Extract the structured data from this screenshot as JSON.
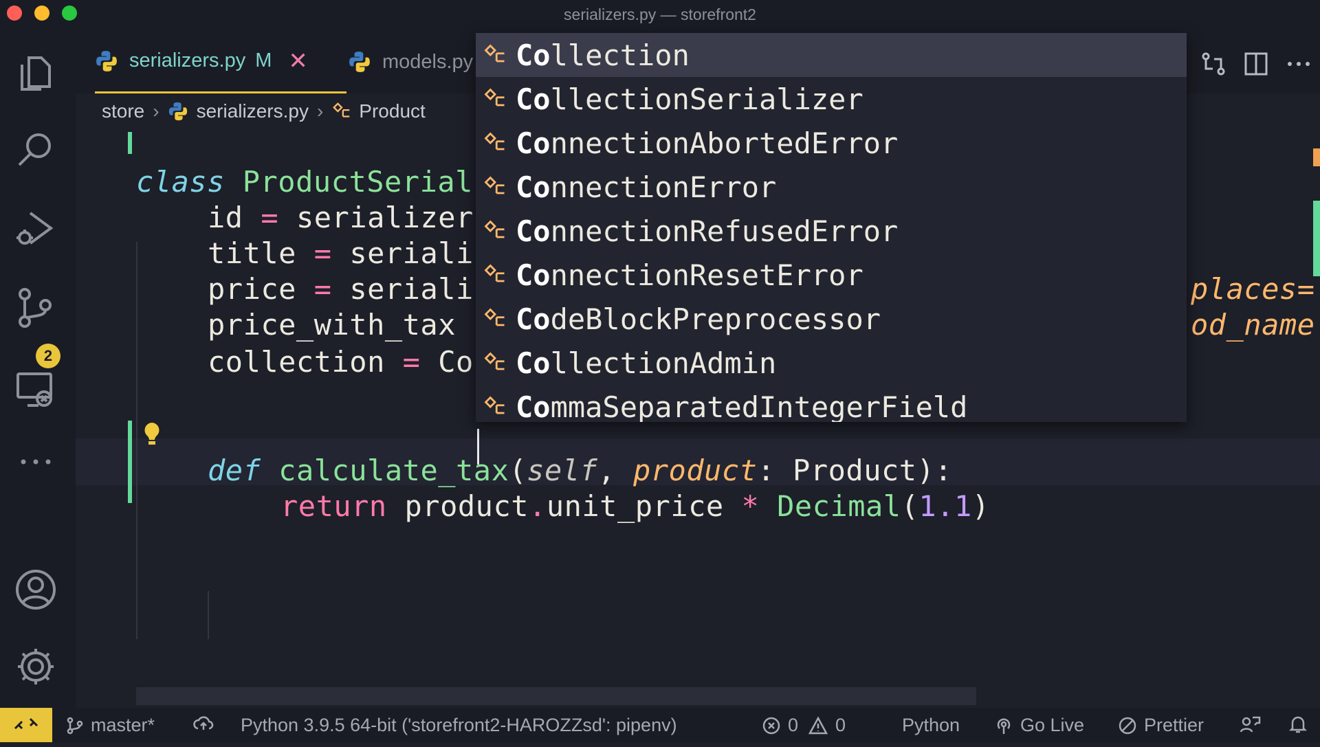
{
  "window": {
    "title": "serializers.py — storefront2"
  },
  "colors": {
    "accent": "#e8c53a",
    "tab_active_text": "#7ed4cb",
    "modified_gutter": "#63d99a",
    "remote_bg": "#e8c53a"
  },
  "activity_bar": {
    "items": [
      "explorer-icon",
      "search-icon",
      "run-debug-icon",
      "source-control-icon",
      "remote-explorer-icon",
      "more-icon"
    ],
    "scm_badge": "2",
    "bottom": [
      "accounts-icon",
      "settings-gear-icon"
    ]
  },
  "tabs": [
    {
      "label": "serializers.py",
      "status": "M",
      "close": "✕",
      "active": true
    },
    {
      "label": "models.py",
      "active": false
    }
  ],
  "breadcrumbs": [
    "store",
    "serializers.py",
    "Product"
  ],
  "code": {
    "line_class": {
      "kw": "class",
      "name": "ProductSerial"
    },
    "line_id": {
      "name": "id",
      "op": "=",
      "val": "serializer"
    },
    "line_title": {
      "name": "title",
      "op": "=",
      "val": "seriali"
    },
    "line_price": {
      "name": "price",
      "op": "=",
      "val": "seriali",
      "tail": "places="
    },
    "line_pwt": {
      "name": "price_with_tax",
      "tail": "od_name"
    },
    "line_collection": {
      "name": "collection",
      "op": "=",
      "val": "Co"
    },
    "line_def": {
      "kw": "def",
      "fn": "calculate_tax",
      "open": "(",
      "self": "self",
      "comma": ",",
      "param": "product",
      "colon": ":",
      "type": "Product",
      "close": "):"
    },
    "line_return": {
      "kw": "return",
      "expr": "product",
      "dot": ".",
      "attr": "unit_price",
      "op": "*",
      "fn": "Decimal",
      "open": "(",
      "num": "1.1",
      "close": ")"
    }
  },
  "suggestions": [
    {
      "hl": "Co",
      "rest": "llection",
      "selected": true
    },
    {
      "hl": "Co",
      "rest": "llectionSerializer"
    },
    {
      "hl": "Co",
      "rest": "nnectionAbortedError"
    },
    {
      "hl": "Co",
      "rest": "nnectionError"
    },
    {
      "hl": "Co",
      "rest": "nnectionRefusedError"
    },
    {
      "hl": "Co",
      "rest": "nnectionResetError"
    },
    {
      "hl": "Co",
      "rest": "deBlockPreprocessor"
    },
    {
      "hl": "Co",
      "rest": "llectionAdmin"
    },
    {
      "hl": "Co",
      "rest": "mmaSeparatedIntegerField"
    }
  ],
  "status_bar": {
    "branch": "master*",
    "interpreter": "Python 3.9.5 64-bit ('storefront2-HAROZZsd': pipenv)",
    "errors": "0",
    "warnings": "0",
    "language": "Python",
    "go_live": "Go Live",
    "prettier": "Prettier"
  }
}
